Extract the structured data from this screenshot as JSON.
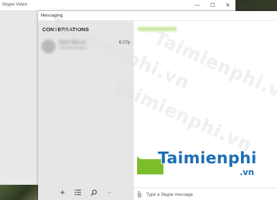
{
  "background_window": {
    "title": "Skype Video",
    "controls": {
      "minimize": "—",
      "maximize": "☐",
      "close": "✕"
    }
  },
  "messaging_window": {
    "title": "Messaging"
  },
  "sidebar": {
    "heading": "CONVERSATIONS",
    "conversations": [
      {
        "name": "Ryan Barnes",
        "time": "6:27p"
      }
    ],
    "toolbar": [
      {
        "icon": "plus-icon",
        "glyph": "+"
      },
      {
        "icon": "list-icon"
      },
      {
        "icon": "search-icon"
      },
      {
        "icon": "more-icon",
        "glyph": "···"
      }
    ]
  },
  "chat": {
    "compose_placeholder": "Type a Skype message",
    "accent_color": "#7cbd2c"
  },
  "watermark": {
    "text": "Taimienphi.vn",
    "logo_main": "Taimienphi",
    "logo_sub": ".vn"
  }
}
